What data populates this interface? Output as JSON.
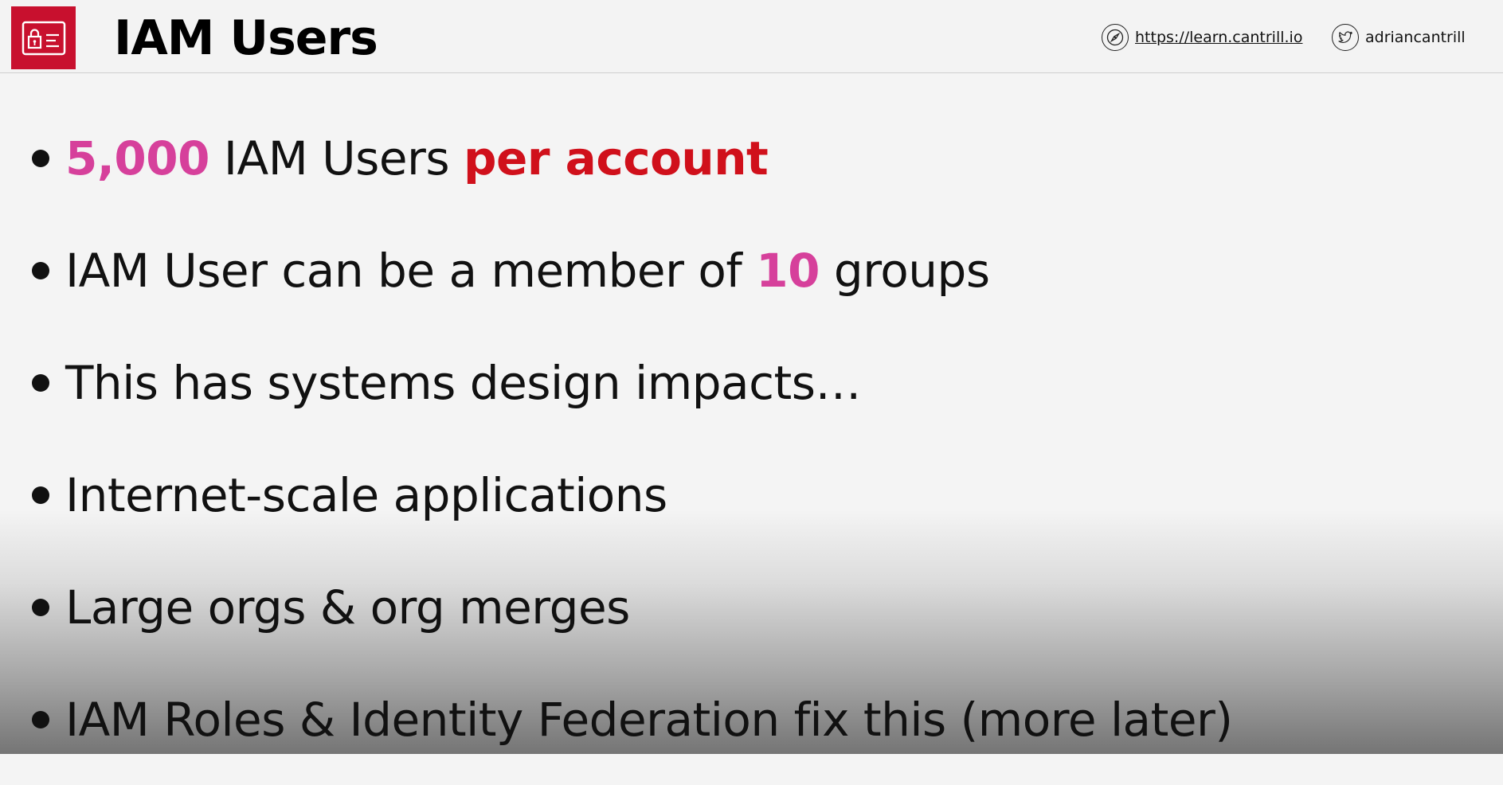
{
  "header": {
    "title": "IAM Users",
    "logo_icon": "id-card-lock-icon",
    "website_icon": "compass-icon",
    "website_url": "https://learn.cantrill.io",
    "social_icon": "twitter-icon",
    "social_handle": "adriancantrill"
  },
  "colors": {
    "accent_pink": "#d6409b",
    "accent_red": "#d0101b",
    "logo_bg": "#c8102e"
  },
  "bullets": [
    {
      "parts": [
        {
          "text": "5,000",
          "style": "pink"
        },
        {
          "text": " IAM Users ",
          "style": "normal"
        },
        {
          "text": "per account",
          "style": "red"
        }
      ]
    },
    {
      "parts": [
        {
          "text": "IAM User can be a member of ",
          "style": "normal"
        },
        {
          "text": "10",
          "style": "pink"
        },
        {
          "text": " groups",
          "style": "normal"
        }
      ]
    },
    {
      "parts": [
        {
          "text": "This has systems design impacts…",
          "style": "normal"
        }
      ]
    },
    {
      "parts": [
        {
          "text": "Internet-scale applications",
          "style": "normal"
        }
      ]
    },
    {
      "parts": [
        {
          "text": "Large orgs & org merges",
          "style": "normal"
        }
      ]
    },
    {
      "parts": [
        {
          "text": "IAM Roles & Identity Federation fix this (more later)",
          "style": "normal"
        }
      ]
    }
  ]
}
